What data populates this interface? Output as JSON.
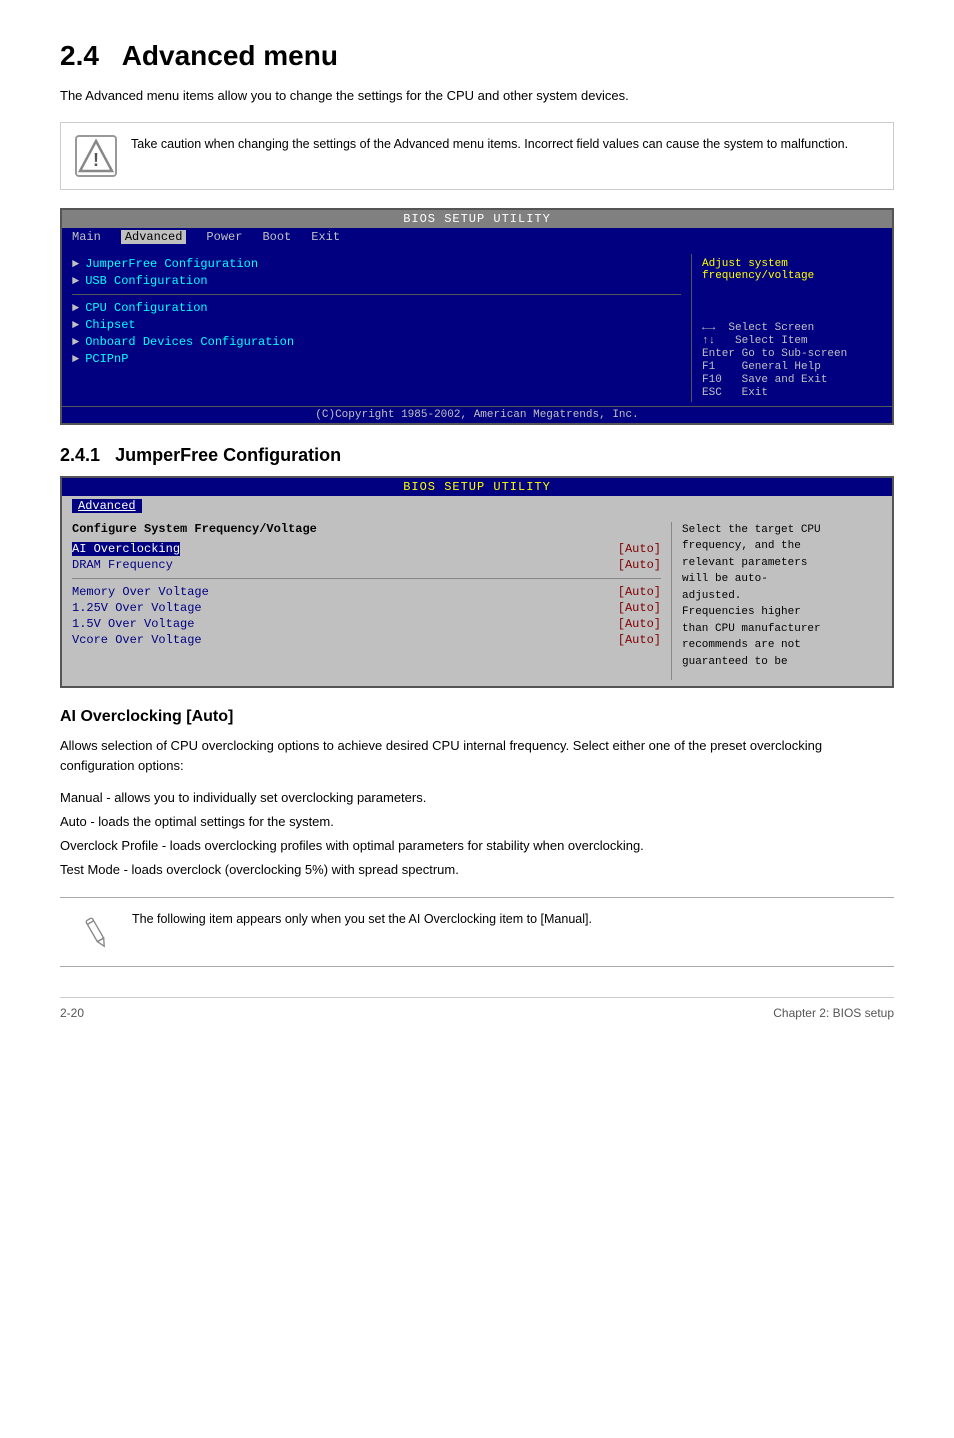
{
  "page": {
    "title_num": "2.4",
    "title_text": "Advanced menu",
    "intro": "The Advanced menu items allow you to change the settings for the CPU and other system devices.",
    "warning": {
      "text": "Take caution when changing the settings of the Advanced menu items. Incorrect field values can cause the system to malfunction."
    }
  },
  "bios1": {
    "title": "BIOS SETUP UTILITY",
    "menu_items": [
      "Main",
      "Advanced",
      "Power",
      "Boot",
      "Exit"
    ],
    "active_menu": "Advanced",
    "left_items": [
      {
        "label": "JumperFree Configuration",
        "type": "submenu"
      },
      {
        "label": "USB Configuration",
        "type": "submenu"
      }
    ],
    "left_items2": [
      {
        "label": "CPU Configuration",
        "type": "submenu"
      },
      {
        "label": "Chipset",
        "type": "submenu"
      },
      {
        "label": "Onboard Devices Configuration",
        "type": "submenu"
      },
      {
        "label": "PCIPnP",
        "type": "submenu"
      }
    ],
    "right_text": "Adjust system\nfrequency/voltage",
    "keys": [
      "←→  Select Screen",
      "↑↓   Select Item",
      "Enter Go to Sub-screen",
      "F1    General Help",
      "F10   Save and Exit",
      "ESC   Exit"
    ],
    "footer": "(C)Copyright 1985-2002, American Megatrends, Inc."
  },
  "subsection1": {
    "num": "2.4.1",
    "title": "JumperFree Configuration"
  },
  "bios2": {
    "title": "BIOS SETUP UTILITY",
    "active_menu": "Advanced",
    "config_header": "Configure System Frequency/Voltage",
    "rows": [
      {
        "label": "AI Overclocking",
        "value": "[Auto]",
        "selected": true
      },
      {
        "label": "DRAM Frequency",
        "value": "[Auto]",
        "selected": false
      }
    ],
    "rows2": [
      {
        "label": "Memory Over Voltage",
        "value": "[Auto]"
      },
      {
        "label": "1.25V Over Voltage",
        "value": "[Auto]"
      },
      {
        "label": "1.5V Over Voltage",
        "value": "[Auto]"
      },
      {
        "label": "Vcore Over Voltage",
        "value": "[Auto]"
      }
    ],
    "right_text": "Select the target CPU\nfrequency, and the\nrelevant parameters\nwill be auto-\nadjusted.\nFrequencies higher\nthan CPU manufacturer\nrecommends are not\nguaranteed to be"
  },
  "ai_overclocking": {
    "title": "AI Overclocking [Auto]",
    "intro": "Allows selection of CPU overclocking options to achieve desired CPU internal frequency. Select either one of the preset overclocking configuration options:",
    "options": [
      "Manual - allows you to individually set overclocking parameters.",
      "Auto - loads the optimal settings for the system.",
      "Overclock Profile - loads overclocking profiles with optimal parameters for stability when overclocking.",
      "Test Mode - loads overclock (overclocking 5%) with spread spectrum."
    ],
    "note": "The following item appears only when you set the AI Overclocking item to [Manual]."
  },
  "footer": {
    "left": "2-20",
    "right": "Chapter 2: BIOS setup"
  }
}
